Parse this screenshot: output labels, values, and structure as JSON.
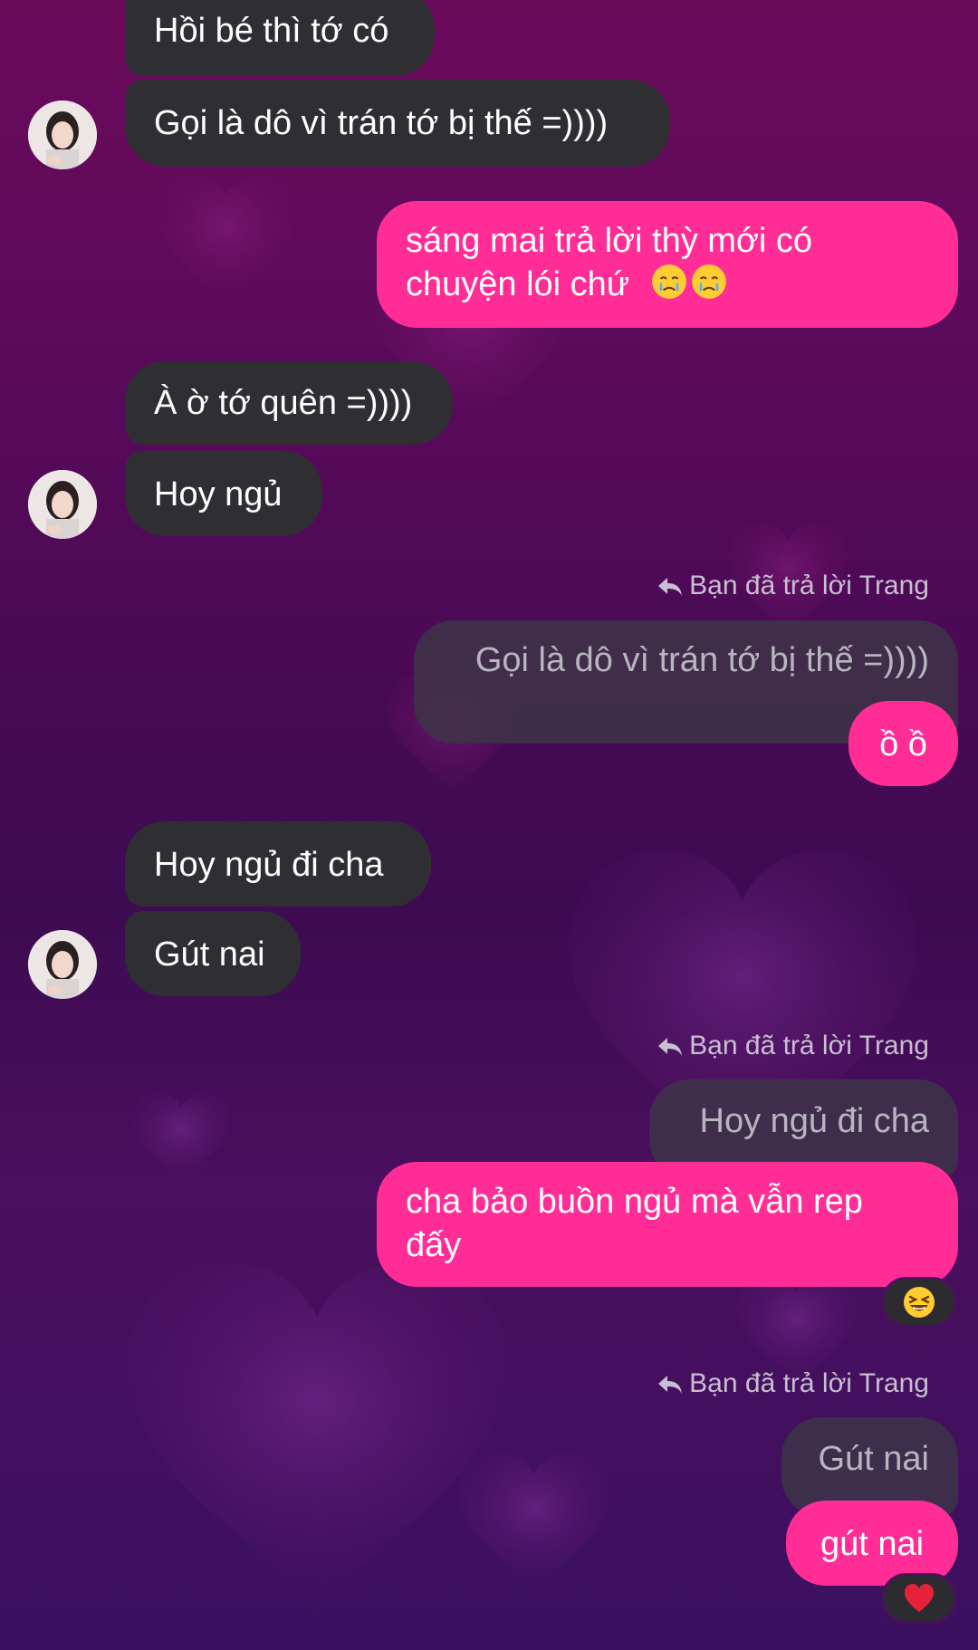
{
  "messages": {
    "m1": "Hồi bé thì tớ có",
    "m2": "Gọi là dô vì trán tớ bị thế =))))",
    "m3_line1": "sáng mai trả lời thỳ mới có",
    "m3_line2": "chuyện lói chứ",
    "m4": "À ờ tớ quên =))))",
    "m5": "Hoy ngủ",
    "m6_quote": "Gọi là dô vì trán tớ bị thế =))))",
    "m6": "ồ ồ",
    "m7": "Hoy ngủ đi cha",
    "m8": "Gút nai",
    "m9_quote": "Hoy ngủ đi cha",
    "m9_line1": "cha bảo buồn ngủ mà vẫn rep",
    "m9_line2": "đấy",
    "m10_quote": "Gút nai",
    "m10": "gút nai"
  },
  "reply_labels": {
    "r1": "Bạn đã trả lời Trang",
    "r2": "Bạn đã trả lời Trang",
    "r3": "Bạn đã trả lời Trang"
  },
  "reactions": {
    "on_m9": "laughing-emoji",
    "on_m10": "heart-emoji"
  },
  "inline_emoji": {
    "m3": [
      "crying-face-emoji",
      "crying-face-emoji"
    ]
  },
  "colors": {
    "incoming_bubble": "#2f2f33",
    "outgoing_bubble": "#ff2d95",
    "background_top": "#6c0a5a",
    "background_bottom": "#3b1060"
  }
}
